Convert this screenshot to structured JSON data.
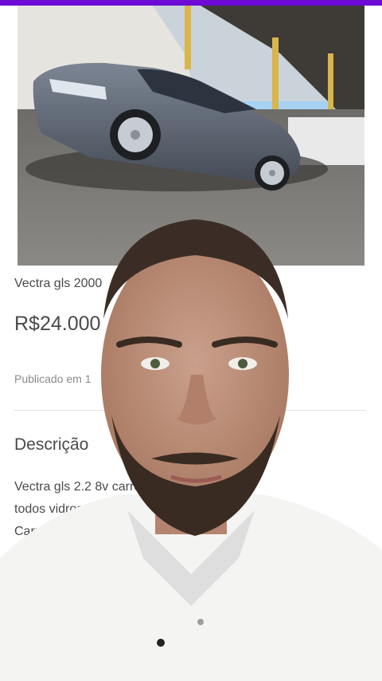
{
  "colors": {
    "accent": "#6d0ad6"
  },
  "listing": {
    "photo_alt": "car-photo",
    "title": "Vectra gls 2000",
    "price": "R$24.000",
    "published": "Publicado em 1",
    "description_heading": "Descrição",
    "description_lines": [
      "Vectra gls 2.2 8v carro com",
      "todos vidros",
      "Carro co"
    ]
  }
}
